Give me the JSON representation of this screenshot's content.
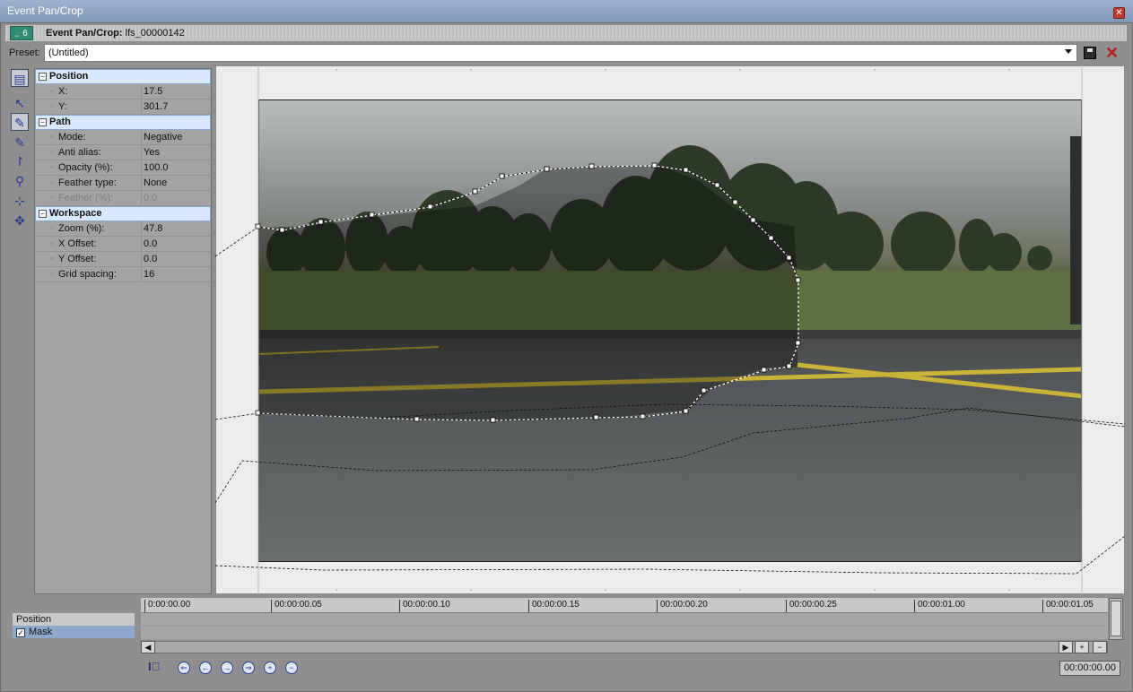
{
  "window": {
    "title": "Event Pan/Crop",
    "close_label": "✕"
  },
  "event": {
    "badge": "6",
    "label": "Event Pan/Crop:",
    "name": "lfs_00000142"
  },
  "preset": {
    "label": "Preset:",
    "value": "(Untitled)"
  },
  "properties": {
    "position": {
      "title": "Position",
      "rows": [
        {
          "k": "X:",
          "v": "17.5"
        },
        {
          "k": "Y:",
          "v": "301.7"
        }
      ]
    },
    "path": {
      "title": "Path",
      "rows": [
        {
          "k": "Mode:",
          "v": "Negative"
        },
        {
          "k": "Anti alias:",
          "v": "Yes"
        },
        {
          "k": "Opacity (%):",
          "v": "100.0"
        },
        {
          "k": "Feather type:",
          "v": "None"
        },
        {
          "k": "Feather (%):",
          "v": "0.0"
        }
      ]
    },
    "workspace": {
      "title": "Workspace",
      "rows": [
        {
          "k": "Zoom (%):",
          "v": "47.8"
        },
        {
          "k": "X Offset:",
          "v": "0.0"
        },
        {
          "k": "Y Offset:",
          "v": "0.0"
        },
        {
          "k": "Grid spacing:",
          "v": "16"
        }
      ]
    }
  },
  "timeline": {
    "tracks": [
      "Position",
      "Mask"
    ],
    "ticks": [
      "0:00:00.00",
      "00:00:00.05",
      "00:00:00.10",
      "00:00:00.15",
      "00:00:00.20",
      "00:00:00.25",
      "00:00:01.00",
      "00:00:01.05"
    ],
    "current_time": "00:00:00.00"
  },
  "icons": {
    "tools": [
      "show-properties-icon",
      "normal-edit-icon",
      "anchor-creation-icon",
      "anchor-add-icon",
      "anchor-delete-icon",
      "zoom-icon",
      "enable-snapping-icon",
      "move-freely-icon"
    ],
    "nav": [
      "first-keyframe-icon",
      "previous-keyframe-icon",
      "next-keyframe-icon",
      "last-keyframe-icon",
      "create-keyframe-icon",
      "delete-keyframe-icon"
    ]
  }
}
